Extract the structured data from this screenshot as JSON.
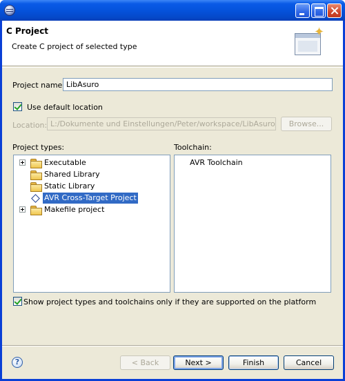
{
  "window": {
    "title": "",
    "banner_title": "C Project",
    "banner_description": "Create C project of selected type"
  },
  "form": {
    "project_name_label": "Project name:",
    "project_name_value": "LibAsuro",
    "use_default_location_label": "Use default location",
    "use_default_location_checked": true,
    "location_label": "Location:",
    "location_value": "L:/Dokumente und Einstellungen/Peter/workspace/LibAsuro",
    "browse_label": "Browse...",
    "project_types_label": "Project types:",
    "toolchain_label": "Toolchain:",
    "show_supported_label": "Show project types and toolchains only if they are supported on the platform",
    "show_supported_checked": true
  },
  "project_types": [
    {
      "label": "Executable",
      "icon": "folder-icon",
      "expandable": true,
      "selected": false
    },
    {
      "label": "Shared Library",
      "icon": "folder-icon",
      "expandable": false,
      "selected": false
    },
    {
      "label": "Static Library",
      "icon": "folder-icon",
      "expandable": false,
      "selected": false
    },
    {
      "label": "AVR Cross-Target Project",
      "icon": "diamond-icon",
      "expandable": false,
      "selected": true
    },
    {
      "label": "Makefile project",
      "icon": "folder-icon",
      "expandable": true,
      "selected": false
    }
  ],
  "toolchains": [
    {
      "label": "AVR Toolchain"
    }
  ],
  "buttons": {
    "back": "< Back",
    "next": "Next >",
    "finish": "Finish",
    "cancel": "Cancel",
    "help": "?"
  }
}
